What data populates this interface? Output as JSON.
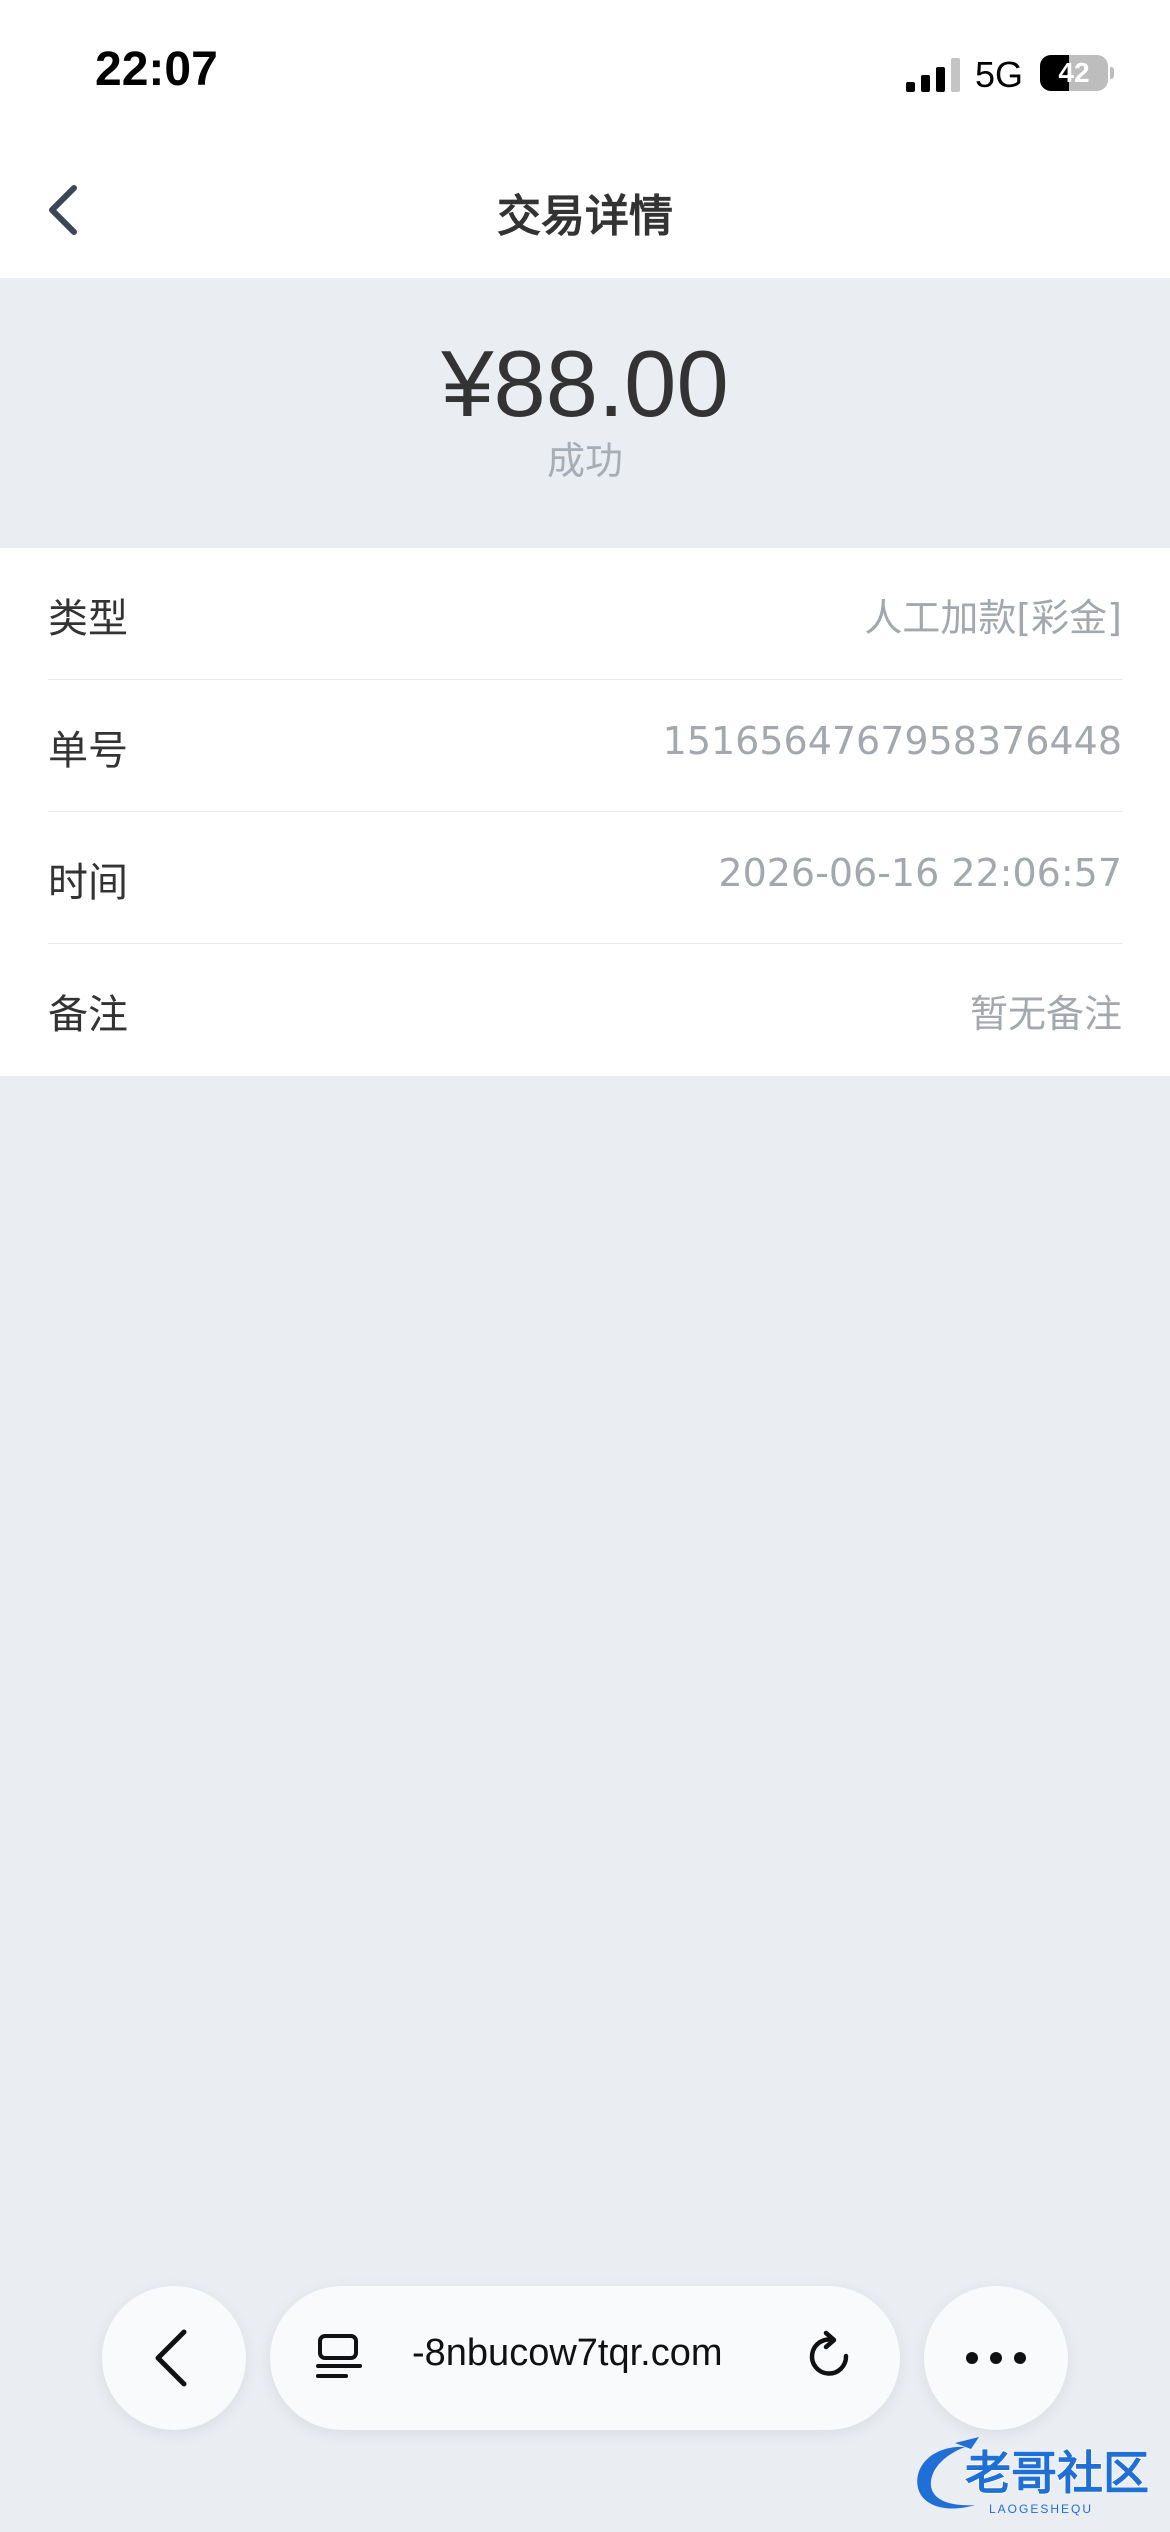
{
  "status_bar": {
    "time": "22:07",
    "network": "5G",
    "battery": "42",
    "battery_level": 0.42
  },
  "nav": {
    "title": "交易详情",
    "back_icon": "chevron-left-icon"
  },
  "transaction": {
    "amount": "¥88.00",
    "status": "成功"
  },
  "details": {
    "type_label": "类型",
    "type_value": "人工加款[彩金]",
    "order_label": "单号",
    "order_value": "1516564767958376448",
    "time_label": "时间",
    "time_value": "2026-06-16 22:06:57",
    "note_label": "备注",
    "note_value": "暂无备注"
  },
  "browser": {
    "url": "-8nbucow7tqr.com",
    "icons": [
      "chevron-left-icon",
      "tabs-icon",
      "reload-icon",
      "more-icon"
    ]
  },
  "watermark": {
    "text": "老哥社区",
    "subtext": "LAOGESHEQU"
  },
  "colors": {
    "page_background": "#eaeef3",
    "card_background": "#ffffff",
    "label_text": "#333333",
    "value_text": "#a3a8ae",
    "watermark_blue": "#1f6fd6"
  }
}
